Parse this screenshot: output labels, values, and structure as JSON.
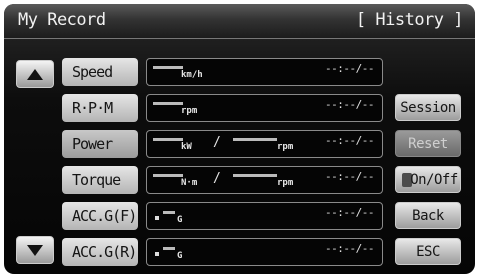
{
  "header": {
    "title": "My Record",
    "history_label": "[ History ]"
  },
  "rows": [
    {
      "label": "Speed",
      "unit1": "km/h",
      "time": "--:--/--"
    },
    {
      "label": "R·P·M",
      "unit1": "rpm",
      "time": "--:--/--"
    },
    {
      "label": "Power",
      "unit1": "kW",
      "unit2": "rpm",
      "sep": "/",
      "time": "--:--/--"
    },
    {
      "label": "Torque",
      "unit1": "N·m",
      "unit2": "rpm",
      "sep": "/",
      "time": "--:--/--"
    },
    {
      "label": "ACC.G(F)",
      "unit1": "G",
      "time": "--:--/--"
    },
    {
      "label": "ACC.G(R)",
      "unit1": "G",
      "time": "--:--/--"
    }
  ],
  "buttons": {
    "session": "Session",
    "reset": "Reset",
    "onoff": "On/Off",
    "back": "Back",
    "esc": "ESC"
  },
  "colors": {
    "screen_bg": "#050505",
    "button_face": "#d6d6d6",
    "text_dark": "#161616"
  },
  "icons": {
    "scroll_up": "triangle-up-icon",
    "scroll_down": "triangle-down-icon"
  }
}
